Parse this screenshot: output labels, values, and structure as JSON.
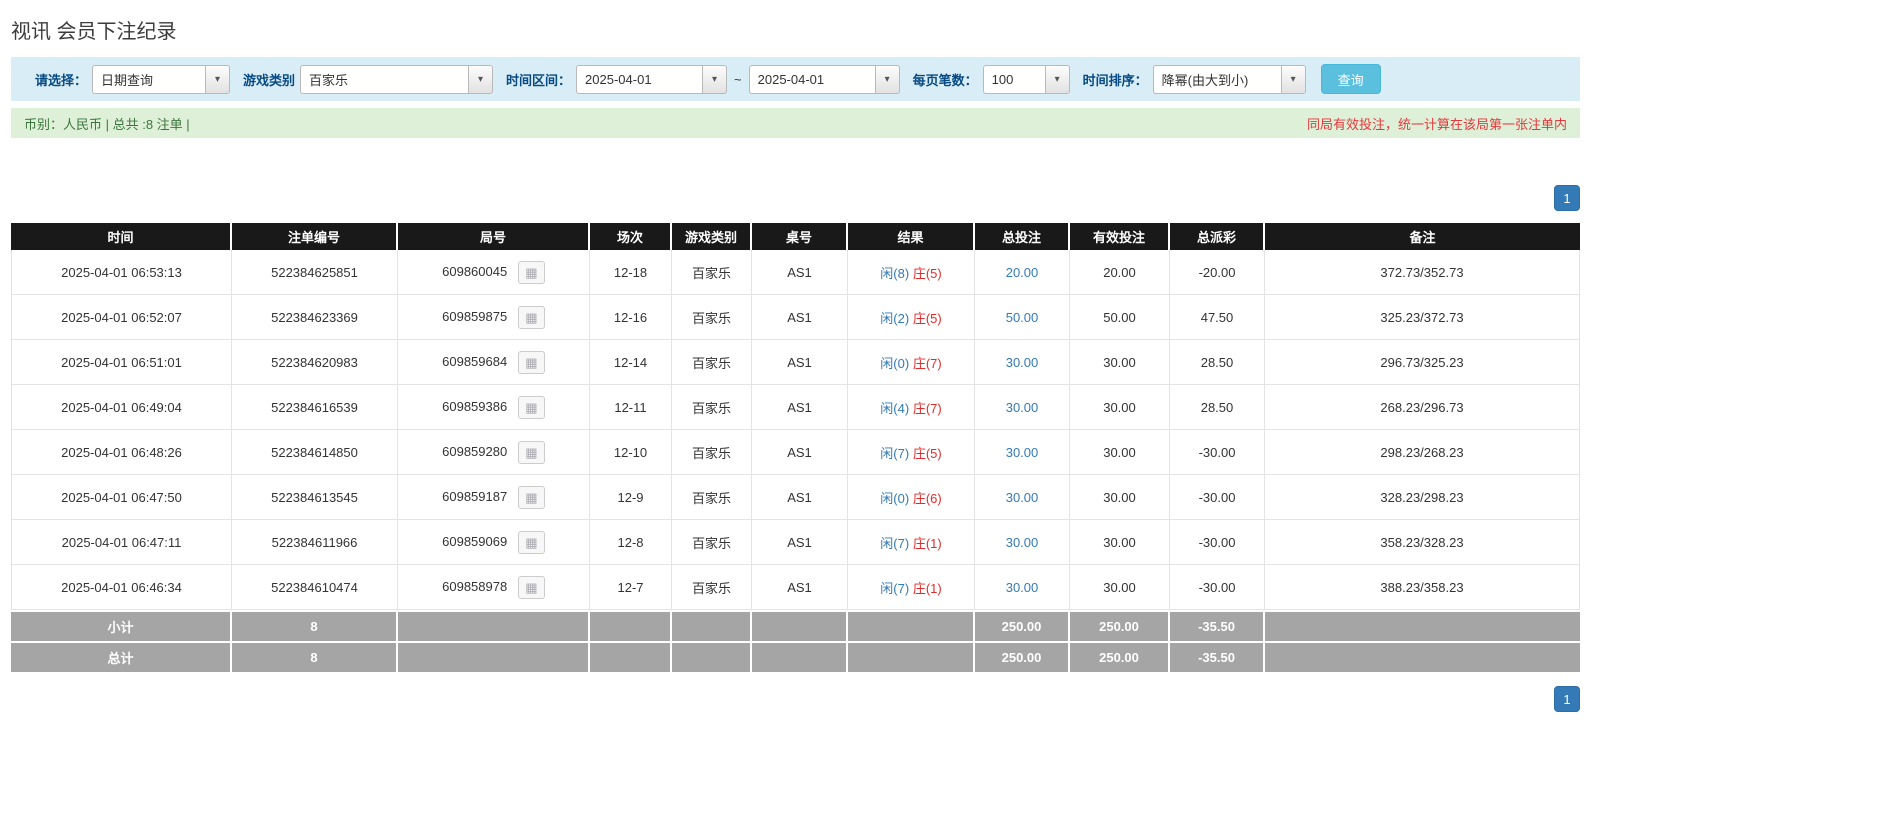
{
  "icons": {
    "caret_down": "▾",
    "round_detail": "▦"
  },
  "page": {
    "title": "视讯 会员下注纪录"
  },
  "filters": {
    "select_label": "请选择：",
    "select_value": "日期查询",
    "game_type_label": "游戏类别",
    "game_type_value": "百家乐",
    "date_range_label": "时间区间：",
    "date_from": "2025-04-01",
    "date_separator": "~",
    "date_to": "2025-04-01",
    "page_size_label": "每页笔数：",
    "page_size_value": "100",
    "sort_label": "时间排序：",
    "sort_value": "降幂(由大到小)",
    "search_button_label": "查询"
  },
  "info_bar": {
    "summary": "币别：人民币 | 总共 :8 注单 |",
    "notice": "同局有效投注，统一计算在该局第一张注单内"
  },
  "pagination": {
    "page": "1"
  },
  "table": {
    "headers": [
      "时间",
      "注单编号",
      "局号",
      "场次",
      "游戏类别",
      "桌号",
      "结果",
      "总投注",
      "有效投注",
      "总派彩",
      "备注"
    ],
    "rows": [
      {
        "time": "2025-04-01 06:53:13",
        "bet_id": "522384625851",
        "round": "609860045",
        "session": "12-18",
        "game": "百家乐",
        "table_no": "AS1",
        "result_player": "闲(8)",
        "result_banker": "庄(5)",
        "total_bet": "20.00",
        "valid_bet": "20.00",
        "payout": "-20.00",
        "note": "372.73/352.73"
      },
      {
        "time": "2025-04-01 06:52:07",
        "bet_id": "522384623369",
        "round": "609859875",
        "session": "12-16",
        "game": "百家乐",
        "table_no": "AS1",
        "result_player": "闲(2)",
        "result_banker": "庄(5)",
        "total_bet": "50.00",
        "valid_bet": "50.00",
        "payout": "47.50",
        "note": "325.23/372.73"
      },
      {
        "time": "2025-04-01 06:51:01",
        "bet_id": "522384620983",
        "round": "609859684",
        "session": "12-14",
        "game": "百家乐",
        "table_no": "AS1",
        "result_player": "闲(0)",
        "result_banker": "庄(7)",
        "total_bet": "30.00",
        "valid_bet": "30.00",
        "payout": "28.50",
        "note": "296.73/325.23"
      },
      {
        "time": "2025-04-01 06:49:04",
        "bet_id": "522384616539",
        "round": "609859386",
        "session": "12-11",
        "game": "百家乐",
        "table_no": "AS1",
        "result_player": "闲(4)",
        "result_banker": "庄(7)",
        "total_bet": "30.00",
        "valid_bet": "30.00",
        "payout": "28.50",
        "note": "268.23/296.73"
      },
      {
        "time": "2025-04-01 06:48:26",
        "bet_id": "522384614850",
        "round": "609859280",
        "session": "12-10",
        "game": "百家乐",
        "table_no": "AS1",
        "result_player": "闲(7)",
        "result_banker": "庄(5)",
        "total_bet": "30.00",
        "valid_bet": "30.00",
        "payout": "-30.00",
        "note": "298.23/268.23"
      },
      {
        "time": "2025-04-01 06:47:50",
        "bet_id": "522384613545",
        "round": "609859187",
        "session": "12-9",
        "game": "百家乐",
        "table_no": "AS1",
        "result_player": "闲(0)",
        "result_banker": "庄(6)",
        "total_bet": "30.00",
        "valid_bet": "30.00",
        "payout": "-30.00",
        "note": "328.23/298.23"
      },
      {
        "time": "2025-04-01 06:47:11",
        "bet_id": "522384611966",
        "round": "609859069",
        "session": "12-8",
        "game": "百家乐",
        "table_no": "AS1",
        "result_player": "闲(7)",
        "result_banker": "庄(1)",
        "total_bet": "30.00",
        "valid_bet": "30.00",
        "payout": "-30.00",
        "note": "358.23/328.23"
      },
      {
        "time": "2025-04-01 06:46:34",
        "bet_id": "522384610474",
        "round": "609858978",
        "session": "12-7",
        "game": "百家乐",
        "table_no": "AS1",
        "result_player": "闲(7)",
        "result_banker": "庄(1)",
        "total_bet": "30.00",
        "valid_bet": "30.00",
        "payout": "-30.00",
        "note": "388.23/358.23"
      }
    ],
    "subtotal": {
      "label": "小计",
      "count": "8",
      "total_bet": "250.00",
      "valid_bet": "250.00",
      "payout": "-35.50"
    },
    "total": {
      "label": "总计",
      "count": "8",
      "total_bet": "250.00",
      "valid_bet": "250.00",
      "payout": "-35.50"
    }
  }
}
